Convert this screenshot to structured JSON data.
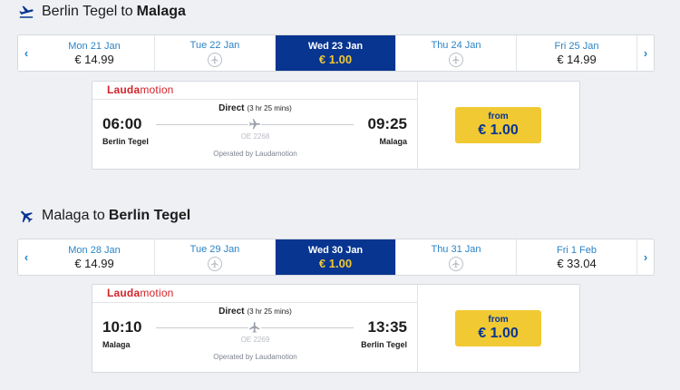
{
  "outbound": {
    "title_from": "Berlin Tegel",
    "title_to_word": "to",
    "title_to": "Malaga",
    "prev_arrow": "‹",
    "next_arrow": "›",
    "dates": [
      {
        "label": "Mon 21 Jan",
        "price": "€ 14.99",
        "selected": false,
        "available": true
      },
      {
        "label": "Tue 22 Jan",
        "price": "",
        "selected": false,
        "available": false
      },
      {
        "label": "Wed 23 Jan",
        "price": "€ 1.00",
        "selected": true,
        "available": true
      },
      {
        "label": "Thu 24 Jan",
        "price": "",
        "selected": false,
        "available": false
      },
      {
        "label": "Fri 25 Jan",
        "price": "€ 14.99",
        "selected": false,
        "available": true
      }
    ],
    "flight": {
      "airline_a": "Lauda",
      "airline_b": "motion",
      "dep_time": "06:00",
      "dep_city": "Berlin Tegel",
      "arr_time": "09:25",
      "arr_city": "Malaga",
      "type": "Direct",
      "duration": "(3 hr 25 mins)",
      "flight_no": "OE 2268",
      "operated_by": "Operated by Laudamotion",
      "price_from": "from",
      "price": "€ 1.00"
    }
  },
  "return": {
    "title_from": "Malaga",
    "title_to_word": "to",
    "title_to": "Berlin Tegel",
    "prev_arrow": "‹",
    "next_arrow": "›",
    "dates": [
      {
        "label": "Mon 28 Jan",
        "price": "€ 14.99",
        "selected": false,
        "available": true
      },
      {
        "label": "Tue 29 Jan",
        "price": "",
        "selected": false,
        "available": false
      },
      {
        "label": "Wed 30 Jan",
        "price": "€ 1.00",
        "selected": true,
        "available": true
      },
      {
        "label": "Thu 31 Jan",
        "price": "",
        "selected": false,
        "available": false
      },
      {
        "label": "Fri 1 Feb",
        "price": "€ 33.04",
        "selected": false,
        "available": true
      }
    ],
    "flight": {
      "airline_a": "Lauda",
      "airline_b": "motion",
      "dep_time": "10:10",
      "dep_city": "Malaga",
      "arr_time": "13:35",
      "arr_city": "Berlin Tegel",
      "type": "Direct",
      "duration": "(3 hr 25 mins)",
      "flight_no": "OE 2269",
      "operated_by": "Operated by Laudamotion",
      "price_from": "from",
      "price": "€ 1.00"
    }
  },
  "colors": {
    "selected_bg": "#073590",
    "selected_price": "#f1c933",
    "date_label": "#2c83c6",
    "price_button": "#f1c933",
    "brand_red": "#d3232a"
  },
  "icons": {
    "title_outbound": "plane-right-icon",
    "title_return": "plane-left-icon",
    "no_flight": "no-flight-icon",
    "route": "plane-icon"
  }
}
